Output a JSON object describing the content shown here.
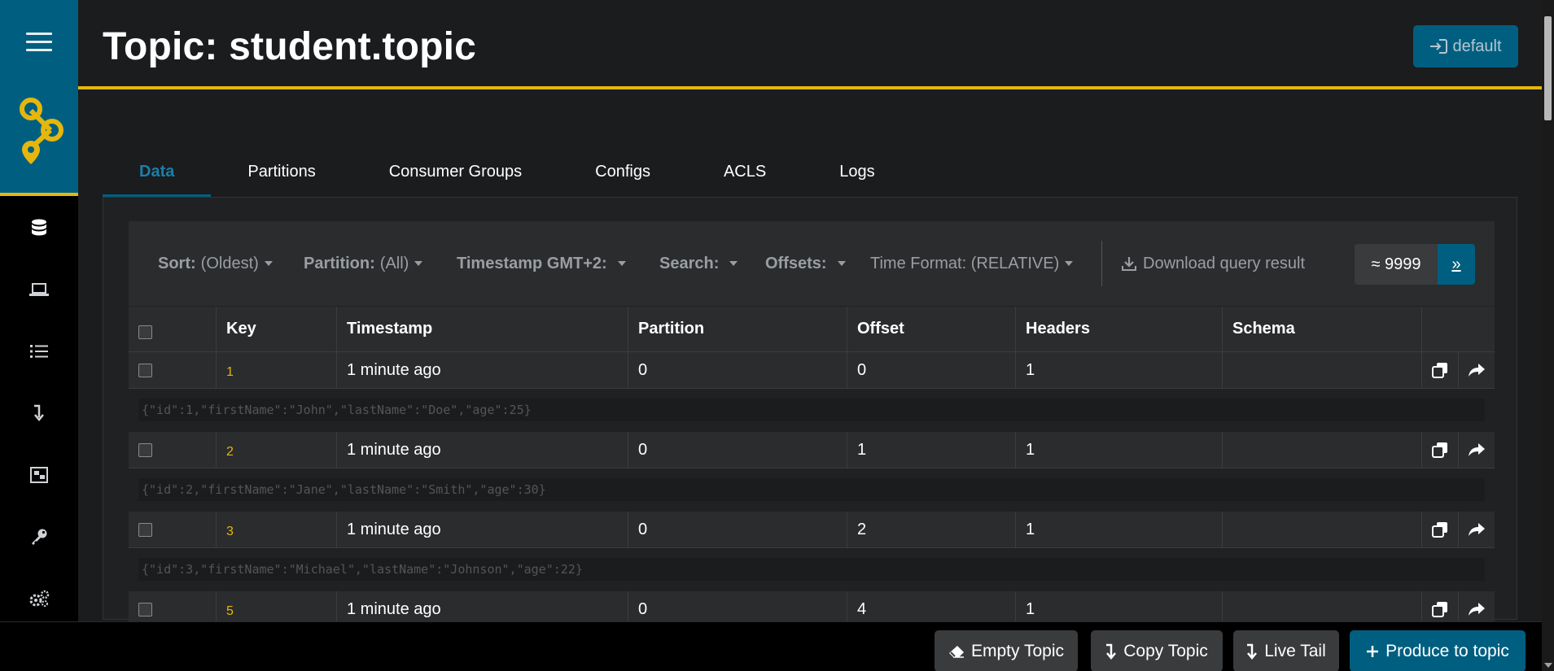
{
  "page": {
    "title": "Topic: student.topic"
  },
  "header": {
    "login_label": "default"
  },
  "sidebar": {
    "items": [
      {
        "icon": "database-icon"
      },
      {
        "icon": "laptop-icon"
      },
      {
        "icon": "list-icon"
      },
      {
        "icon": "level-down-icon"
      },
      {
        "icon": "schema-icon"
      },
      {
        "icon": "key-icon"
      },
      {
        "icon": "cogs-icon"
      }
    ]
  },
  "tabs": [
    {
      "label": "Data"
    },
    {
      "label": "Partitions"
    },
    {
      "label": "Consumer Groups"
    },
    {
      "label": "Configs"
    },
    {
      "label": "ACLS"
    },
    {
      "label": "Logs"
    }
  ],
  "toolbar": {
    "sort": {
      "label": "Sort:",
      "value": "(Oldest)"
    },
    "partition": {
      "label": "Partition:",
      "value": "(All)"
    },
    "timestamp": {
      "label": "Timestamp GMT+2:"
    },
    "search": {
      "label": "Search:"
    },
    "offsets": {
      "label": "Offsets:"
    },
    "time_format": {
      "label": "Time Format: (RELATIVE)"
    },
    "download": {
      "label": "Download query result"
    },
    "count": "≈ 9999",
    "next": "»"
  },
  "table": {
    "headers": [
      "Key",
      "Timestamp",
      "Partition",
      "Offset",
      "Headers",
      "Schema"
    ],
    "rows": [
      {
        "key": "1",
        "timestamp": "1 minute ago",
        "partition": "0",
        "offset": "0",
        "headers": "1",
        "schema": "",
        "value": "{\"id\":1,\"firstName\":\"John\",\"lastName\":\"Doe\",\"age\":25}"
      },
      {
        "key": "2",
        "timestamp": "1 minute ago",
        "partition": "0",
        "offset": "1",
        "headers": "1",
        "schema": "",
        "value": "{\"id\":2,\"firstName\":\"Jane\",\"lastName\":\"Smith\",\"age\":30}"
      },
      {
        "key": "3",
        "timestamp": "1 minute ago",
        "partition": "0",
        "offset": "2",
        "headers": "1",
        "schema": "",
        "value": "{\"id\":3,\"firstName\":\"Michael\",\"lastName\":\"Johnson\",\"age\":22}"
      },
      {
        "key": "5",
        "timestamp": "1 minute ago",
        "partition": "0",
        "offset": "4",
        "headers": "1",
        "schema": "",
        "value": ""
      }
    ]
  },
  "actions": {
    "empty": "Empty Topic",
    "copy": "Copy Topic",
    "live_tail": "Live Tail",
    "produce": "Produce to topic"
  },
  "colors": {
    "brand": "#005f81",
    "accent": "#e5b60c",
    "background": "#1b1c1e"
  }
}
